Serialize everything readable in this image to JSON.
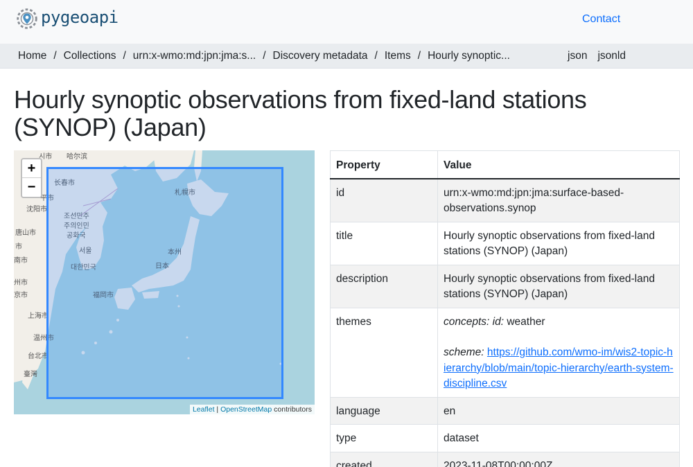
{
  "header": {
    "logo_text": "pygeoapi",
    "contact_label": "Contact"
  },
  "breadcrumb": {
    "items": [
      "Home",
      "Collections",
      "urn:x-wmo:md:jpn:jma:s...",
      "Discovery metadata",
      "Items",
      "Hourly synoptic..."
    ],
    "separator": "/",
    "formats": [
      "json",
      "jsonld"
    ]
  },
  "page": {
    "title": "Hourly synoptic observations from fixed-land stations (SYNOP) (Japan)"
  },
  "map": {
    "zoom_in": "+",
    "zoom_out": "−",
    "attribution": {
      "leaflet": "Leaflet",
      "separator": "|",
      "osm": "OpenStreetMap",
      "suffix": "contributors"
    },
    "labels": [
      "시市",
      "哈尔滨",
      "长春市",
      "札幌市",
      "沈阳市",
      "조선민주",
      "주의인민",
      "공화국",
      "서울",
      "대한민국",
      "本州",
      "日本",
      "福岡市",
      "唐山市",
      "市",
      "南市",
      "州市",
      "京市",
      "上海市",
      "温州市",
      "台北市",
      "臺灣",
      "平市"
    ],
    "bbox_color": "#3388ff"
  },
  "table": {
    "headers": [
      "Property",
      "Value"
    ],
    "rows": {
      "id": {
        "key": "id",
        "value": "urn:x-wmo:md:jpn:jma:surface-based-observations.synop"
      },
      "title": {
        "key": "title",
        "value": "Hourly synoptic observations from fixed-land stations (SYNOP) (Japan)"
      },
      "description": {
        "key": "description",
        "value": "Hourly synoptic observations from fixed-land stations (SYNOP) (Japan)"
      },
      "themes": {
        "key": "themes",
        "concepts_label": "concepts:",
        "id_label": "id:",
        "id_value": "weather",
        "scheme_label": "scheme:",
        "scheme_url": "https://github.com/wmo-im/wis2-topic-hierarchy/blob/main/topic-hierarchy/earth-system-discipline.csv"
      },
      "language": {
        "key": "language",
        "value": "en"
      },
      "type": {
        "key": "type",
        "value": "dataset"
      },
      "created": {
        "key": "created",
        "value": "2023-11-08T00:00:00Z"
      }
    }
  }
}
